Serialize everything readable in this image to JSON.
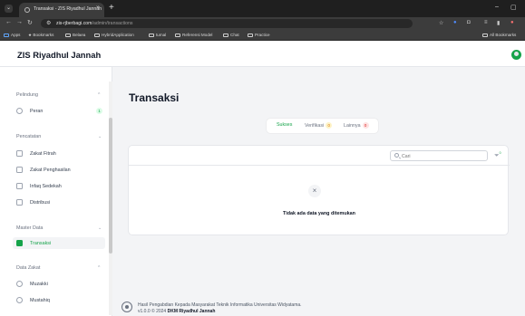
{
  "browser": {
    "tab_title": "Transaksi - ZIS Riyadhul Jannah",
    "tab_close": "×",
    "new_tab": "+",
    "url_host": "zis-rjberbagi.com",
    "url_path": "/admin/transactions",
    "bookmarks": [
      "Apps",
      "Bookmarks",
      "Belaea",
      "HybridApplication",
      "tumal",
      "Referensi Model",
      "Chat",
      "Practice"
    ],
    "all_bookmarks": "All Bookmarks"
  },
  "header": {
    "brand": "ZIS Riyadhul Jannah"
  },
  "sidebar": {
    "groups": [
      {
        "label": "Pelindung"
      },
      {
        "label": "Pencatatan"
      },
      {
        "label": "Master Data"
      },
      {
        "label": "Data Zakat"
      }
    ],
    "items": [
      {
        "label": "Peran",
        "badge": "1"
      },
      {
        "label": "Zakat Fitrah"
      },
      {
        "label": "Zakat Penghasilan"
      },
      {
        "label": "Infaq Sedekah"
      },
      {
        "label": "Distribusi"
      },
      {
        "label": "Transaksi"
      },
      {
        "label": "Muzakki"
      },
      {
        "label": "Mustahiq"
      }
    ]
  },
  "main": {
    "title": "Transaksi",
    "tabs": [
      {
        "label": "Sukses",
        "count": ""
      },
      {
        "label": "Verifikasi",
        "count": "0"
      },
      {
        "label": "Lainnya",
        "count": "0"
      }
    ],
    "search_placeholder": "Cari",
    "empty_icon": "×",
    "empty_message": "Tidak ada data yang ditemukan"
  },
  "footer": {
    "line1": "Hasil Pengabdian Kepada Masyarakat Teknik Informatika Universitas Widyatama.",
    "line2_prefix": "v1.0.0 © 2024 ",
    "line2_org": "DKM Riyadhul Jannah"
  }
}
